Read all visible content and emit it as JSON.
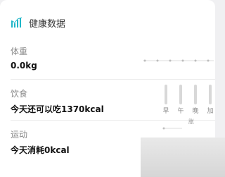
{
  "header": {
    "title": "健康数据",
    "icon": "bar-chart-icon",
    "accent": "#1fb6c8"
  },
  "weight": {
    "label": "体重",
    "value": "0.0kg"
  },
  "diet": {
    "label": "饮食",
    "value": "今天还可以吃1370kcal",
    "meals": [
      "早",
      "午",
      "晚",
      "加"
    ]
  },
  "exercise": {
    "label": "运动",
    "value": "今天消耗0kcal",
    "mini_label": "胀"
  }
}
